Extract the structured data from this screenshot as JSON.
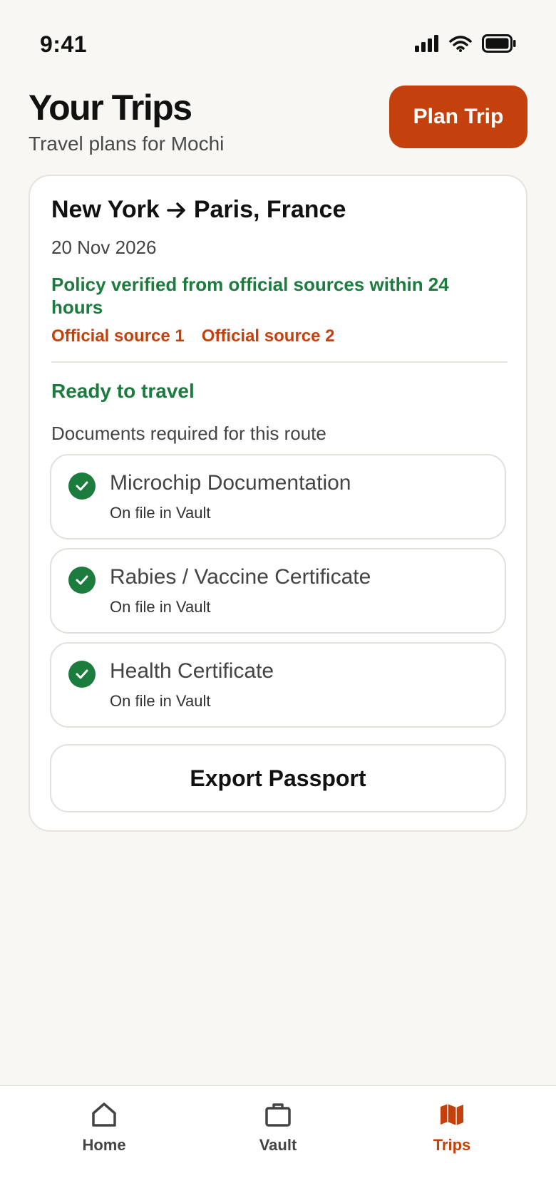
{
  "status_bar": {
    "time": "9:41",
    "icons": [
      "cellular-signal-icon",
      "wifi-icon",
      "battery-icon"
    ]
  },
  "header": {
    "title": "Your Trips",
    "subtitle": "Travel plans for Mochi",
    "plan_button_label": "Plan Trip"
  },
  "trip": {
    "origin": "New York",
    "destination": "Paris, France",
    "arrow_icon": "arrow-right-icon",
    "date": "20 Nov 2026",
    "policy_text": "Policy verified from official sources within 24 hours",
    "sources": [
      "Official source 1",
      "Official source 2"
    ],
    "readiness": "Ready to travel",
    "documents_label": "Documents required for this route",
    "documents": [
      {
        "title": "Microchip Documentation",
        "status": "On file in Vault",
        "icon": "check-circle-icon"
      },
      {
        "title": "Rabies / Vaccine Certificate",
        "status": "On file in Vault",
        "icon": "check-circle-icon"
      },
      {
        "title": "Health Certificate",
        "status": "On file in Vault",
        "icon": "check-circle-icon"
      }
    ],
    "export_button_label": "Export Passport"
  },
  "tab_bar": {
    "tabs": [
      {
        "label": "Home",
        "icon": "home-icon",
        "active": false
      },
      {
        "label": "Vault",
        "icon": "briefcase-icon",
        "active": false
      },
      {
        "label": "Trips",
        "icon": "map-icon",
        "active": true
      }
    ]
  },
  "colors": {
    "accent": "#C4410E",
    "success": "#1C7C3E",
    "background": "#F8F7F4",
    "card": "#FFFFFF",
    "border": "#E6E3DE"
  }
}
